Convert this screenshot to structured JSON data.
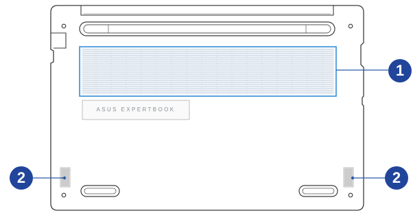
{
  "laptop": {
    "brand_label": "ASUS EXPERTBOOK"
  },
  "callouts": {
    "vent_top": "1",
    "speaker_left": "2",
    "speaker_right": "2"
  },
  "colors": {
    "outline": "#3c3c3c",
    "vent_highlight": "#3a8fd6",
    "callout_fill": "#21459b",
    "leader_line": "#2a5ca8"
  }
}
